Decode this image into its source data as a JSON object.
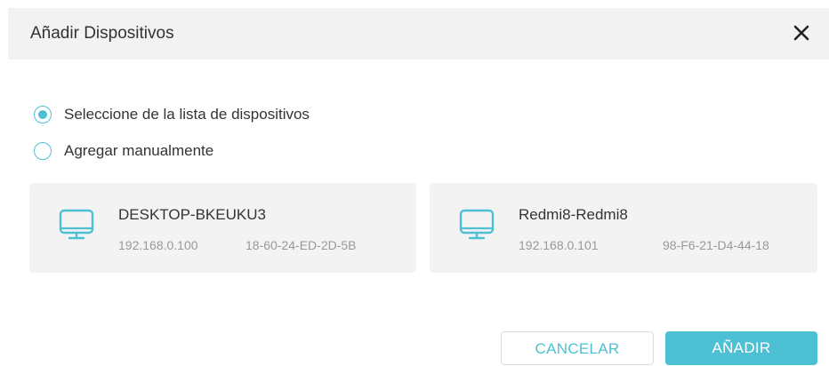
{
  "dialog": {
    "title": "Añadir Dispositivos",
    "close_icon": "close-icon"
  },
  "options": {
    "from_list_label": "Seleccione de la lista de dispositivos",
    "from_list_selected": true,
    "manual_label": "Agregar manualmente",
    "manual_selected": false
  },
  "devices": [
    {
      "icon": "monitor-icon",
      "name": "DESKTOP-BKEUKU3",
      "ip": "192.168.0.100",
      "mac": "18-60-24-ED-2D-5B"
    },
    {
      "icon": "monitor-icon",
      "name": "Redmi8-Redmi8",
      "ip": "192.168.0.101",
      "mac": "98-F6-21-D4-44-18"
    }
  ],
  "buttons": {
    "cancel_label": "CANCELAR",
    "add_label": "AÑADIR"
  },
  "colors": {
    "accent": "#4ec0d3",
    "header_bg": "#f2f2f2",
    "card_bg": "#f3f3f3",
    "text": "#333333",
    "muted_text": "#999999"
  }
}
